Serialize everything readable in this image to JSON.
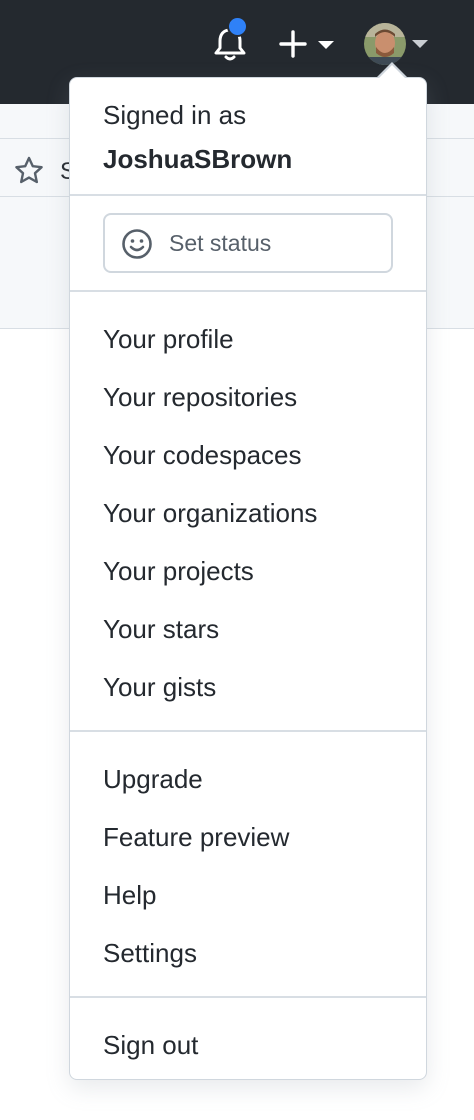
{
  "header": {
    "notification_dot_color": "#2f81f7",
    "icons": [
      "bell-icon",
      "plus-icon",
      "avatar",
      "caret-down-icon"
    ]
  },
  "page": {
    "star_button_label": "S"
  },
  "dropdown": {
    "signed_in_label": "Signed in as",
    "username": "JoshuaSBrown",
    "set_status_label": "Set status",
    "group1": [
      "Your profile",
      "Your repositories",
      "Your codespaces",
      "Your organizations",
      "Your projects",
      "Your stars",
      "Your gists"
    ],
    "group2": [
      "Upgrade",
      "Feature preview",
      "Help",
      "Settings"
    ],
    "sign_out_label": "Sign out"
  }
}
